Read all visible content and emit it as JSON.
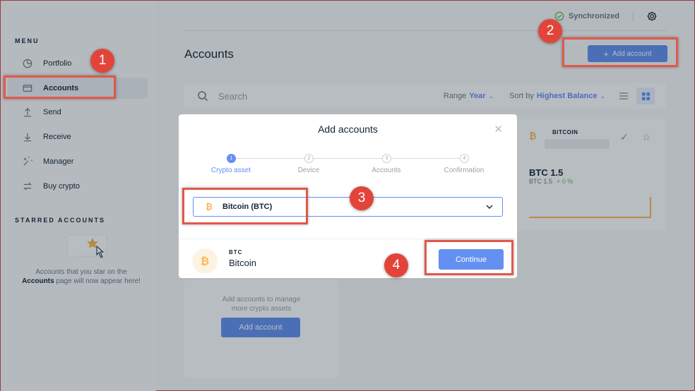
{
  "sidebar": {
    "menu_title": "MENU",
    "items": [
      {
        "label": "Portfolio",
        "icon": "portfolio-icon"
      },
      {
        "label": "Accounts",
        "icon": "wallet-icon"
      },
      {
        "label": "Send",
        "icon": "send-icon"
      },
      {
        "label": "Receive",
        "icon": "receive-icon"
      },
      {
        "label": "Manager",
        "icon": "tools-icon"
      },
      {
        "label": "Buy crypto",
        "icon": "exchange-icon"
      }
    ],
    "starred_title": "STARRED ACCOUNTS",
    "starred_text_before": "Accounts that you star on the",
    "starred_text_bold": "Accounts",
    "starred_text_after": "page will now appear here!"
  },
  "header": {
    "sync_status": "Synchronized",
    "page_title": "Accounts",
    "add_account_label": "Add account"
  },
  "toolbar": {
    "search_placeholder": "Search",
    "range_label": "Range",
    "range_value": "Year",
    "sort_label": "Sort by",
    "sort_value": "Highest Balance"
  },
  "btc_card": {
    "name": "BITCOIN",
    "amount": "BTC 1.5",
    "sub_amount": "BTC 1.5",
    "change": "+ 0 %"
  },
  "add_card": {
    "text_line1": "Add accounts to manage",
    "text_line2": "more crypto assets",
    "button_label": "Add account"
  },
  "modal": {
    "title": "Add accounts",
    "steps": [
      {
        "number": "1",
        "label": "Crypto asset",
        "active": true
      },
      {
        "number": "2",
        "label": "Device",
        "active": false
      },
      {
        "number": "3",
        "label": "Accounts",
        "active": false
      },
      {
        "number": "4",
        "label": "Confirmation",
        "active": false
      }
    ],
    "selected_asset": "Bitcoin (BTC)",
    "footer_ticker": "BTC",
    "footer_name": "Bitcoin",
    "continue_label": "Continue"
  },
  "annotations": [
    "1",
    "2",
    "3",
    "4"
  ],
  "colors": {
    "accent": "#6490f1",
    "bitcoin": "#fcb653",
    "success": "#66be54",
    "highlight": "#e2584a"
  }
}
